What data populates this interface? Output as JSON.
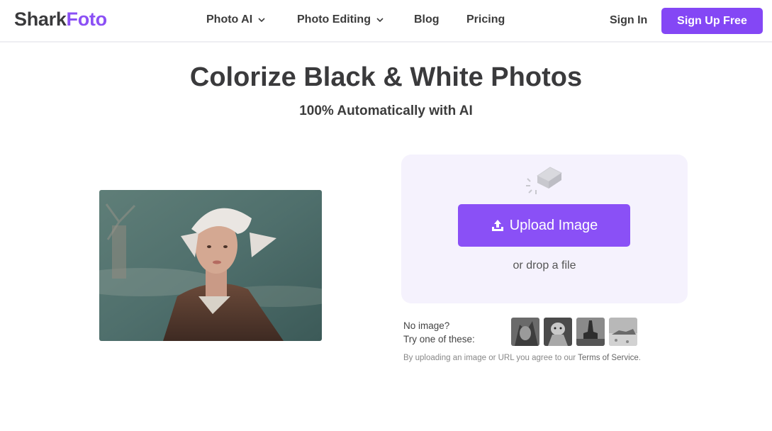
{
  "header": {
    "logo_part1": "Shark",
    "logo_part2": "Foto",
    "nav": [
      {
        "label": "Photo AI",
        "has_dropdown": true
      },
      {
        "label": "Photo Editing",
        "has_dropdown": true
      },
      {
        "label": "Blog",
        "has_dropdown": false
      },
      {
        "label": "Pricing",
        "has_dropdown": false
      }
    ],
    "sign_in": "Sign In",
    "sign_up": "Sign Up Free"
  },
  "hero": {
    "title": "Colorize Black & White Photos",
    "subtitle": "100% Automatically with AI"
  },
  "upload": {
    "button_label": "Upload Image",
    "drop_text": "or drop a file"
  },
  "samples": {
    "line1": "No image?",
    "line2": "Try one of these:",
    "thumbnails": [
      "sample-photo-1",
      "sample-photo-2",
      "sample-photo-3",
      "sample-photo-4"
    ]
  },
  "terms": {
    "prefix": "By uploading an image or URL you agree to our ",
    "link": "Terms of Service",
    "suffix": "."
  },
  "colors": {
    "brand": "#8447f5",
    "upload_button": "#8a50f6",
    "card_bg": "#f5f2fd"
  },
  "icons": {
    "dropdown": "chevron-down-icon",
    "upload": "upload-icon",
    "placeholder": "eraser-icon"
  }
}
